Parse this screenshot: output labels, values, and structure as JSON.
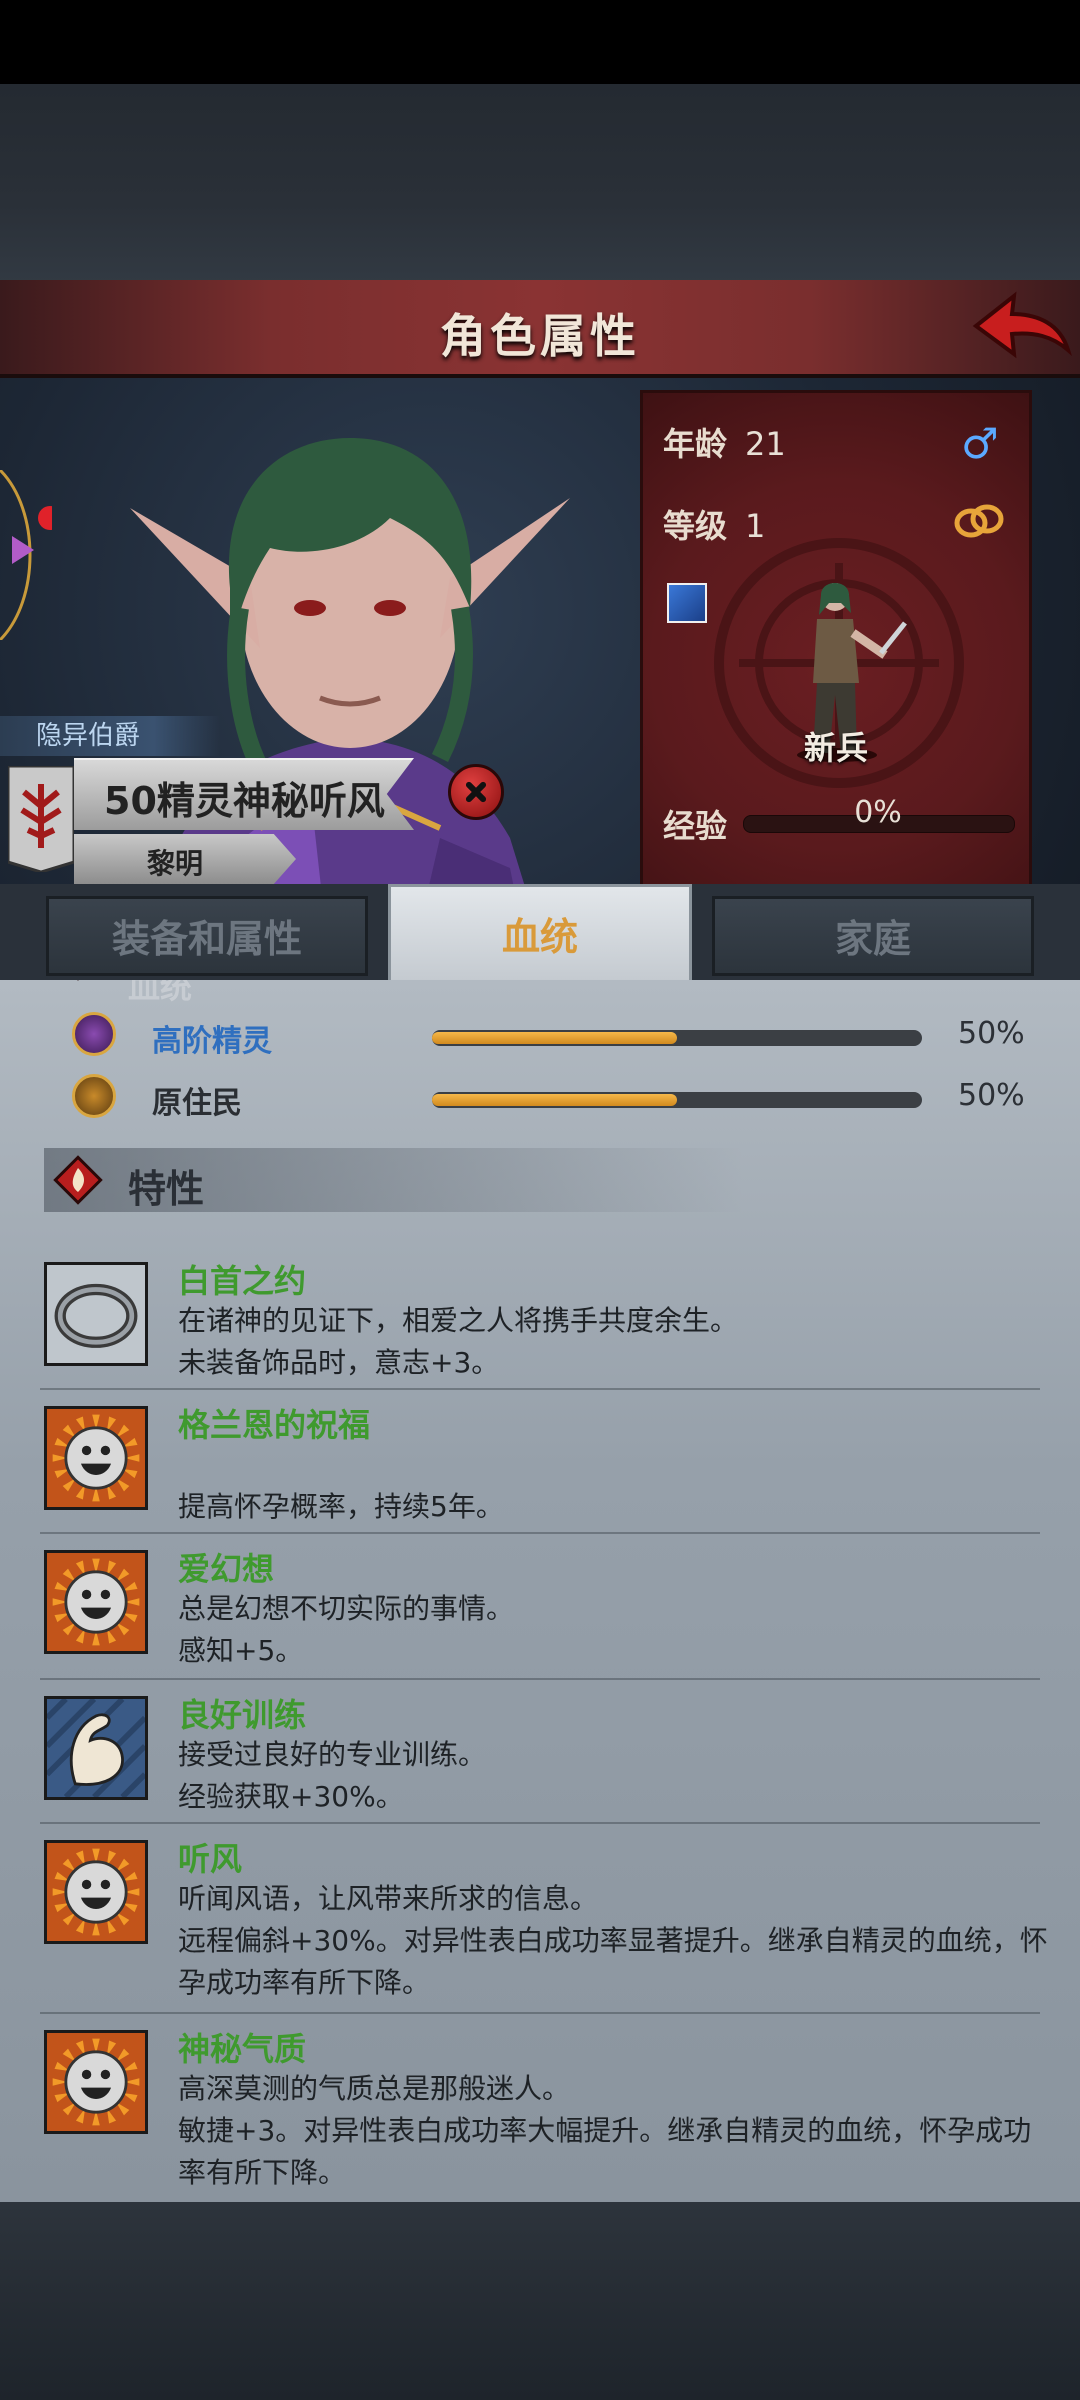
{
  "header": {
    "title": "角色属性"
  },
  "character": {
    "rank": "隐异伯爵",
    "name": "50精灵神秘听风",
    "family": "黎明"
  },
  "stats": {
    "age_label": "年龄",
    "age": "21",
    "level_label": "等级",
    "level": "1",
    "job": "新兵",
    "exp_label": "经验",
    "exp": "0%",
    "exp_progress": 0
  },
  "tabs": [
    {
      "label": "装备和属性"
    },
    {
      "label": "血统"
    },
    {
      "label": "家庭"
    }
  ],
  "bloodline": {
    "section_title": "血统",
    "items": [
      {
        "name": "高阶精灵",
        "percent": "50%",
        "value": 50
      },
      {
        "name": "原住民",
        "percent": "50%",
        "value": 50
      }
    ]
  },
  "traits": {
    "section_title": "特性",
    "items": [
      {
        "name": "白首之约",
        "icon": "ring-icon",
        "desc": "在诸神的见证下，相爱之人将携手共度余生。\n未装备饰品时，意志+3。"
      },
      {
        "name": "格兰恩的祝福",
        "icon": "sun-smile-icon",
        "desc": "\n提高怀孕概率，持续5年。"
      },
      {
        "name": "爱幻想",
        "icon": "sun-smile-icon",
        "desc": "总是幻想不切实际的事情。\n感知+5。"
      },
      {
        "name": "良好训练",
        "icon": "muscle-arm-icon",
        "desc": "接受过良好的专业训练。\n经验获取+30%。"
      },
      {
        "name": "听风",
        "icon": "sun-smile-icon",
        "desc": "听闻风语，让风带来所求的信息。\n远程偏斜+30%。对异性表白成功率显著提升。继承自精灵的血统，怀孕成功率有所下降。"
      },
      {
        "name": "神秘气质",
        "icon": "sun-smile-icon",
        "desc": "高深莫测的气质总是那般迷人。\n敏捷+3。对异性表白成功率大幅提升。继承自精灵的血统，怀孕成功率有所下降。"
      }
    ]
  },
  "colors": {
    "title_bar": "#8a3333",
    "stat_panel": "#5a1a1d",
    "trait_name": "#3f9a2e",
    "bar_fill": "#e9a436",
    "tab_active_text": "#d99a3a"
  }
}
